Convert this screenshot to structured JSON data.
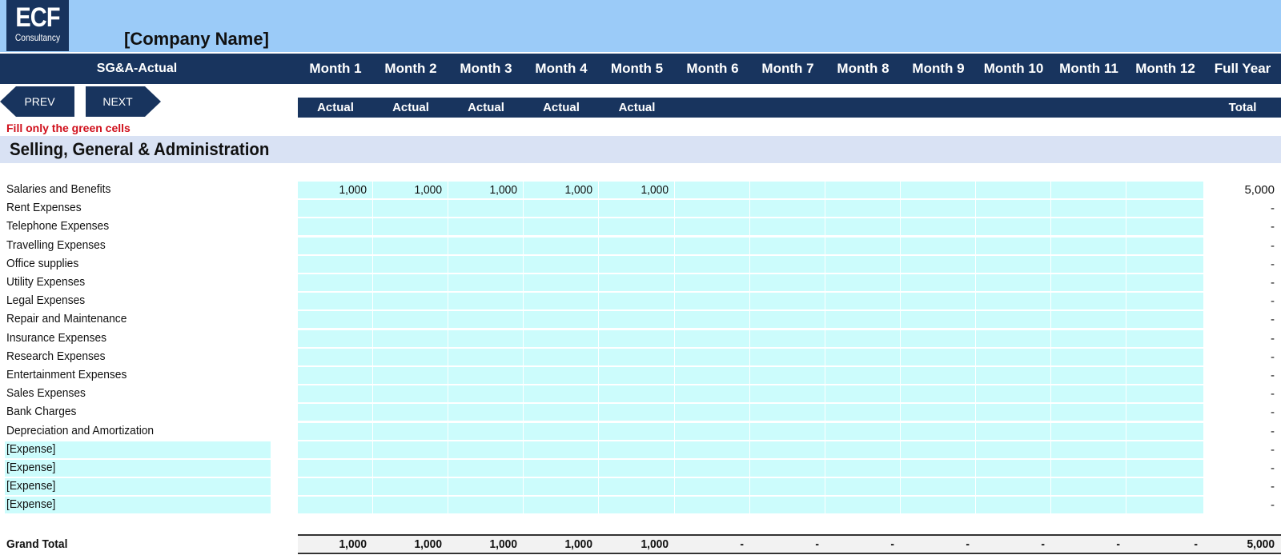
{
  "logo": {
    "big": "ECF",
    "small": "Consultancy"
  },
  "company_name": "[Company Name]",
  "sheet_title": "SG&A-Actual",
  "nav": {
    "prev": "PREV",
    "next": "NEXT"
  },
  "months": [
    "Month 1",
    "Month 2",
    "Month 3",
    "Month 4",
    "Month 5",
    "Month 6",
    "Month 7",
    "Month 8",
    "Month 9",
    "Month 10",
    "Month 11",
    "Month 12"
  ],
  "full_year_label": "Full Year",
  "sub_labels": [
    "Actual",
    "Actual",
    "Actual",
    "Actual",
    "Actual",
    "",
    "",
    "",
    "",
    "",
    "",
    ""
  ],
  "total_sub_label": "Total",
  "fill_note": "Fill only the green cells",
  "section_title": "Selling, General & Administration",
  "rows": [
    {
      "label": "Salaries and Benefits",
      "values": [
        "1,000",
        "1,000",
        "1,000",
        "1,000",
        "1,000",
        "",
        "",
        "",
        "",
        "",
        "",
        ""
      ],
      "total": "5,000",
      "editable_label": false
    },
    {
      "label": "Rent Expenses",
      "values": [
        "",
        "",
        "",
        "",
        "",
        "",
        "",
        "",
        "",
        "",
        "",
        ""
      ],
      "total": "-",
      "editable_label": false
    },
    {
      "label": "Telephone Expenses",
      "values": [
        "",
        "",
        "",
        "",
        "",
        "",
        "",
        "",
        "",
        "",
        "",
        ""
      ],
      "total": "-",
      "editable_label": false
    },
    {
      "label": "Travelling Expenses",
      "values": [
        "",
        "",
        "",
        "",
        "",
        "",
        "",
        "",
        "",
        "",
        "",
        ""
      ],
      "total": "-",
      "editable_label": false
    },
    {
      "label": "Office supplies",
      "values": [
        "",
        "",
        "",
        "",
        "",
        "",
        "",
        "",
        "",
        "",
        "",
        ""
      ],
      "total": "-",
      "editable_label": false
    },
    {
      "label": "Utility Expenses",
      "values": [
        "",
        "",
        "",
        "",
        "",
        "",
        "",
        "",
        "",
        "",
        "",
        ""
      ],
      "total": "-",
      "editable_label": false
    },
    {
      "label": "Legal Expenses",
      "values": [
        "",
        "",
        "",
        "",
        "",
        "",
        "",
        "",
        "",
        "",
        "",
        ""
      ],
      "total": "-",
      "editable_label": false
    },
    {
      "label": "Repair and Maintenance",
      "values": [
        "",
        "",
        "",
        "",
        "",
        "",
        "",
        "",
        "",
        "",
        "",
        ""
      ],
      "total": "-",
      "editable_label": false
    },
    {
      "label": "Insurance Expenses",
      "values": [
        "",
        "",
        "",
        "",
        "",
        "",
        "",
        "",
        "",
        "",
        "",
        ""
      ],
      "total": "-",
      "editable_label": false
    },
    {
      "label": "Research Expenses",
      "values": [
        "",
        "",
        "",
        "",
        "",
        "",
        "",
        "",
        "",
        "",
        "",
        ""
      ],
      "total": "-",
      "editable_label": false
    },
    {
      "label": "Entertainment Expenses",
      "values": [
        "",
        "",
        "",
        "",
        "",
        "",
        "",
        "",
        "",
        "",
        "",
        ""
      ],
      "total": "-",
      "editable_label": false
    },
    {
      "label": "Sales Expenses",
      "values": [
        "",
        "",
        "",
        "",
        "",
        "",
        "",
        "",
        "",
        "",
        "",
        ""
      ],
      "total": "-",
      "editable_label": false
    },
    {
      "label": "Bank Charges",
      "values": [
        "",
        "",
        "",
        "",
        "",
        "",
        "",
        "",
        "",
        "",
        "",
        ""
      ],
      "total": "-",
      "editable_label": false
    },
    {
      "label": "Depreciation and Amortization",
      "values": [
        "",
        "",
        "",
        "",
        "",
        "",
        "",
        "",
        "",
        "",
        "",
        ""
      ],
      "total": "-",
      "editable_label": false
    },
    {
      "label": "[Expense]",
      "values": [
        "",
        "",
        "",
        "",
        "",
        "",
        "",
        "",
        "",
        "",
        "",
        ""
      ],
      "total": "-",
      "editable_label": true
    },
    {
      "label": "[Expense]",
      "values": [
        "",
        "",
        "",
        "",
        "",
        "",
        "",
        "",
        "",
        "",
        "",
        ""
      ],
      "total": "-",
      "editable_label": true
    },
    {
      "label": "[Expense]",
      "values": [
        "",
        "",
        "",
        "",
        "",
        "",
        "",
        "",
        "",
        "",
        "",
        ""
      ],
      "total": "-",
      "editable_label": true
    },
    {
      "label": "[Expense]",
      "values": [
        "",
        "",
        "",
        "",
        "",
        "",
        "",
        "",
        "",
        "",
        "",
        ""
      ],
      "total": "-",
      "editable_label": true
    }
  ],
  "grand_total": {
    "label": "Grand Total",
    "values": [
      "1,000",
      "1,000",
      "1,000",
      "1,000",
      "1,000",
      "-",
      "-",
      "-",
      "-",
      "-",
      "-",
      "-"
    ],
    "total": "5,000"
  },
  "colors": {
    "header_navy": "#18345e",
    "banner_blue": "#9bcbf8",
    "input_green": "#ccfcfc",
    "section_band": "#d9e2f4",
    "note_red": "#d0101c"
  }
}
